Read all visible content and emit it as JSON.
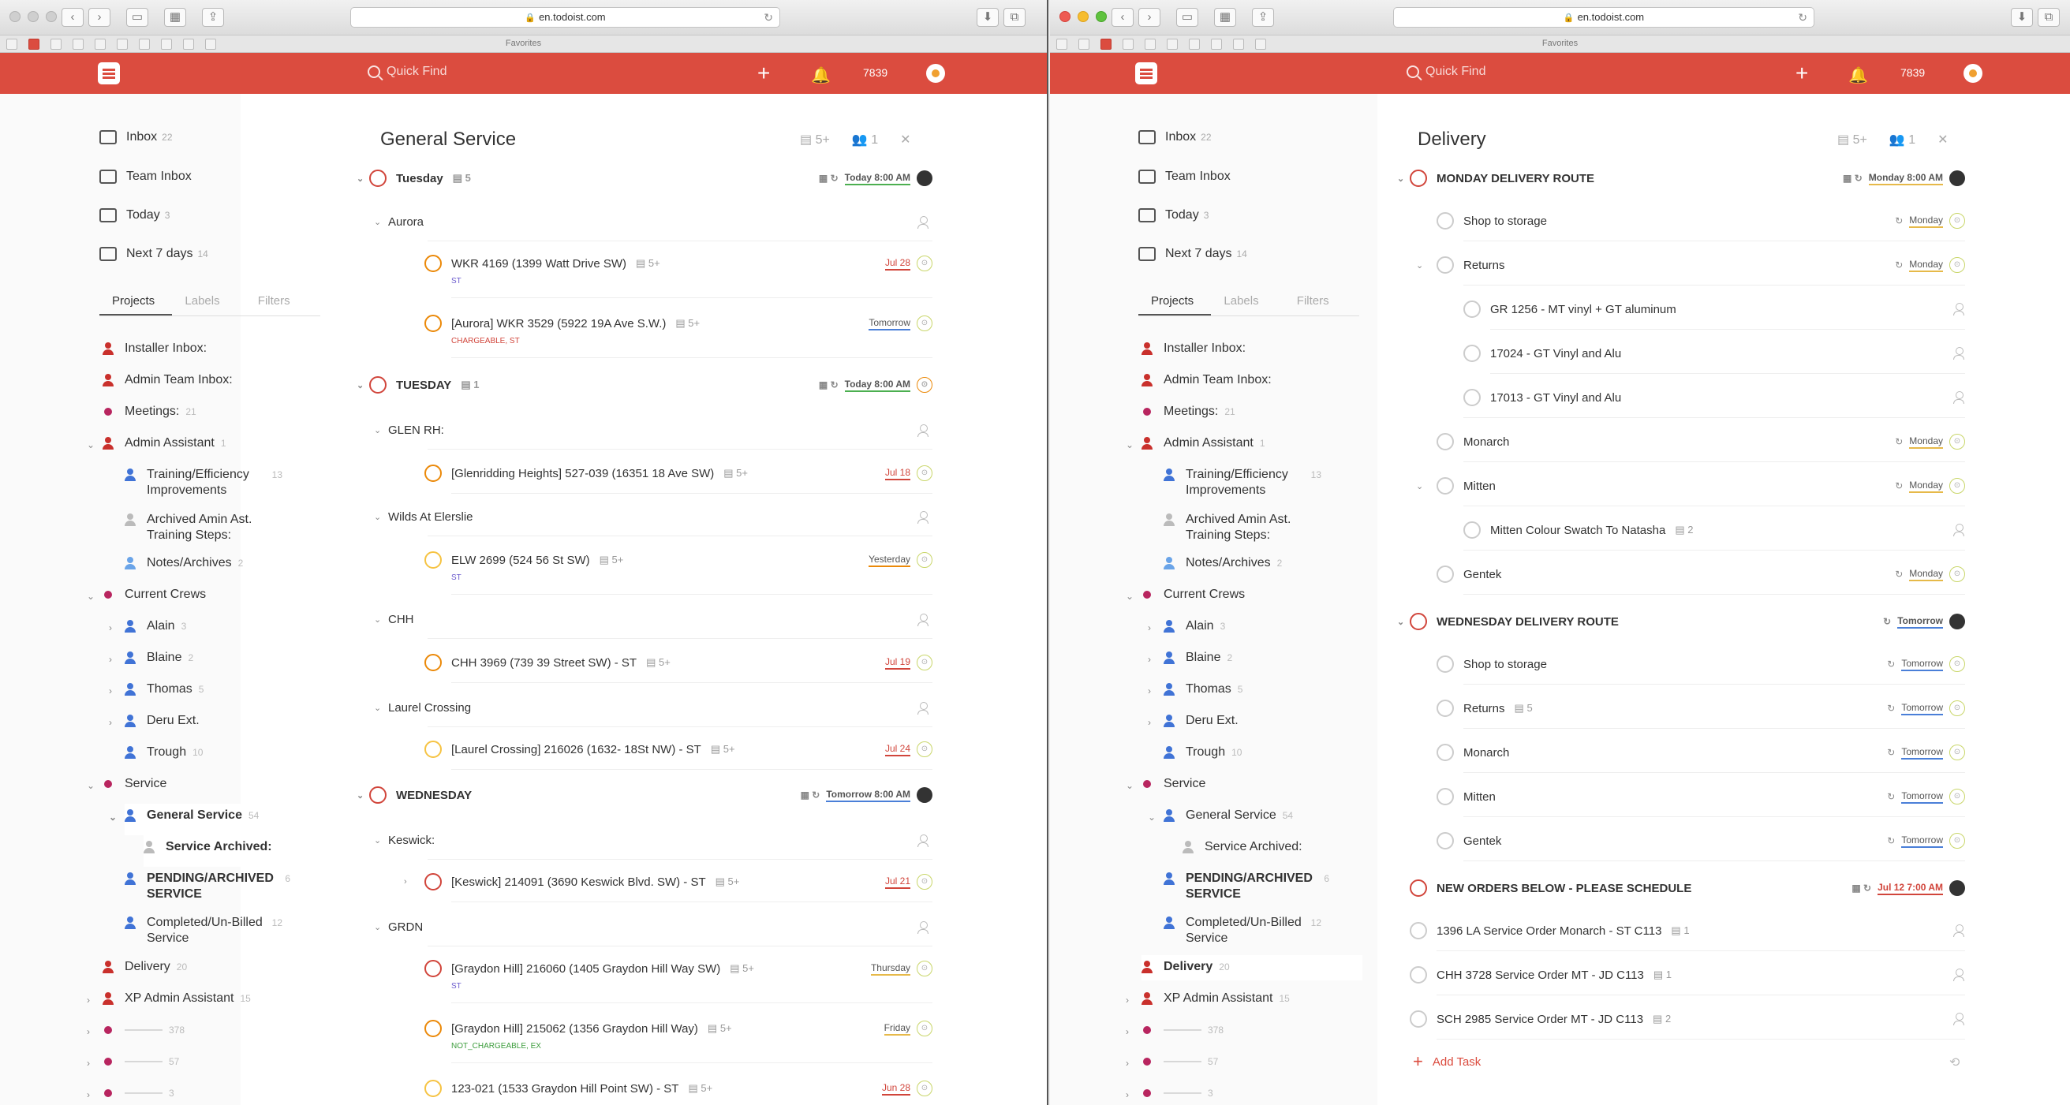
{
  "left": {
    "url": "en.todoist.com",
    "favorites": "Favorites",
    "quick_find": "Quick Find",
    "karma": "7839",
    "nav": [
      {
        "label": "Inbox",
        "count": "22"
      },
      {
        "label": "Team Inbox",
        "count": ""
      },
      {
        "label": "Today",
        "count": "3"
      },
      {
        "label": "Next 7 days",
        "count": "14"
      }
    ],
    "tabs": [
      "Projects",
      "Labels",
      "Filters"
    ],
    "projects": [
      {
        "label": "Installer Inbox:",
        "count": ""
      },
      {
        "label": "Admin Team Inbox:",
        "count": ""
      },
      {
        "label": "Meetings:",
        "count": "21"
      },
      {
        "label": "Admin Assistant",
        "count": "1"
      },
      {
        "label": "Training/Efficiency Improvements",
        "count": "13"
      },
      {
        "label": "Archived Amin Ast. Training Steps:",
        "count": ""
      },
      {
        "label": "Notes/Archives",
        "count": "2"
      },
      {
        "label": "Current Crews",
        "count": ""
      },
      {
        "label": "Alain",
        "count": "3"
      },
      {
        "label": "Blaine",
        "count": "2"
      },
      {
        "label": "Thomas",
        "count": "5"
      },
      {
        "label": "Deru Ext.",
        "count": ""
      },
      {
        "label": "Trough",
        "count": "10"
      },
      {
        "label": "Service",
        "count": ""
      },
      {
        "label": "General Service",
        "count": "54"
      },
      {
        "label": "Service Archived:",
        "count": ""
      },
      {
        "label": "PENDING/ARCHIVED SERVICE",
        "count": "6"
      },
      {
        "label": "Completed/Un-Billed Service",
        "count": "12"
      },
      {
        "label": "Delivery",
        "count": "20"
      },
      {
        "label": "XP Admin Assistant",
        "count": "15"
      },
      {
        "label": "———",
        "count": "378"
      },
      {
        "label": "———",
        "count": "57"
      },
      {
        "label": "———",
        "count": "3"
      }
    ],
    "main": {
      "title": "General Service",
      "header_count1": "5+",
      "header_count2": "1",
      "sections": [
        {
          "name": "Tuesday",
          "comments": "5",
          "date": "Today 8:00 AM"
        },
        {
          "name": "TUESDAY",
          "comments": "1",
          "date": "Today 8:00 AM"
        },
        {
          "name": "WEDNESDAY",
          "comments": "",
          "date": "Tomorrow 8:00 AM"
        }
      ],
      "subsections": [
        "Aurora",
        "GLEN RH:",
        "Wilds At Elerslie",
        "CHH",
        "Laurel Crossing",
        "Keswick:",
        "GRDN"
      ],
      "tasks": [
        {
          "text": "WKR 4169 (1399 Watt Drive SW)",
          "comments": "5+",
          "date": "Jul 28",
          "labels": "ST"
        },
        {
          "text": "[Aurora] WKR 3529 (5922 19A Ave S.W.)",
          "comments": "5+",
          "date": "Tomorrow",
          "labels": "CHARGEABLE, ST"
        },
        {
          "text": "[Glenridding Heights] 527-039 (16351 18 Ave SW)",
          "comments": "5+",
          "date": "Jul 18",
          "labels": ""
        },
        {
          "text": "ELW 2699 (524 56 St SW)",
          "comments": "5+",
          "date": "Yesterday",
          "labels": "ST"
        },
        {
          "text": "CHH 3969 (739 39 Street SW) - ST",
          "comments": "5+",
          "date": "Jul 19",
          "labels": ""
        },
        {
          "text": "[Laurel Crossing] 216026 (1632- 18St NW) - ST",
          "comments": "5+",
          "date": "Jul 24",
          "labels": ""
        },
        {
          "text": "[Keswick] 214091 (3690 Keswick Blvd. SW) - ST",
          "comments": "5+",
          "date": "Jul 21",
          "labels": ""
        },
        {
          "text": "[Graydon Hill] 216060 (1405 Graydon Hill Way SW)",
          "comments": "5+",
          "date": "Thursday",
          "labels": "ST"
        },
        {
          "text": "[Graydon Hill] 215062 (1356 Graydon Hill Way)",
          "comments": "5+",
          "date": "Friday",
          "labels": "NOT_CHARGEABLE, EX"
        },
        {
          "text": "123-021 (1533 Graydon Hill Point SW) - ST",
          "comments": "5+",
          "date": "Jun 28",
          "labels": ""
        }
      ]
    }
  },
  "right": {
    "url": "en.todoist.com",
    "favorites": "Favorites",
    "quick_find": "Quick Find",
    "karma": "7839",
    "main": {
      "title": "Delivery",
      "header_count1": "5+",
      "header_count2": "1",
      "sections": [
        {
          "name": "MONDAY DELIVERY ROUTE",
          "date": "Monday 8:00 AM"
        },
        {
          "name": "WEDNESDAY DELIVERY ROUTE",
          "date": "Tomorrow"
        },
        {
          "name": "NEW ORDERS BELOW - PLEASE SCHEDULE",
          "date": "Jul 12 7:00 AM"
        }
      ],
      "monday_tasks": [
        {
          "text": "Shop to storage",
          "date": "Monday"
        },
        {
          "text": "Returns",
          "date": "Monday"
        },
        {
          "text": "GR 1256 - MT vinyl + GT aluminum",
          "date": ""
        },
        {
          "text": "17024 - GT Vinyl and Alu",
          "date": ""
        },
        {
          "text": "17013 - GT Vinyl and Alu",
          "date": ""
        },
        {
          "text": "Monarch",
          "date": "Monday"
        },
        {
          "text": "Mitten",
          "date": "Monday"
        },
        {
          "text": "Mitten Colour Swatch To Natasha",
          "comments": "2",
          "date": ""
        },
        {
          "text": "Gentek",
          "date": "Monday"
        }
      ],
      "wednesday_tasks": [
        {
          "text": "Shop to storage",
          "comments": "",
          "date": "Tomorrow"
        },
        {
          "text": "Returns",
          "comments": "5",
          "date": "Tomorrow"
        },
        {
          "text": "Monarch",
          "comments": "",
          "date": "Tomorrow"
        },
        {
          "text": "Mitten",
          "comments": "",
          "date": "Tomorrow"
        },
        {
          "text": "Gentek",
          "comments": "",
          "date": "Tomorrow"
        }
      ],
      "new_orders": [
        {
          "text": "1396 LA Service Order Monarch - ST C113",
          "comments": "1"
        },
        {
          "text": "CHH 3728 Service Order MT - JD C113",
          "comments": "1"
        },
        {
          "text": "SCH 2985 Service Order MT - JD C113",
          "comments": "2"
        }
      ],
      "add_task": "Add Task"
    }
  },
  "colors": {
    "brand": "#db4c3f",
    "p1": "#d1453b",
    "p2": "#eb8909",
    "p3": "#f6c343"
  }
}
